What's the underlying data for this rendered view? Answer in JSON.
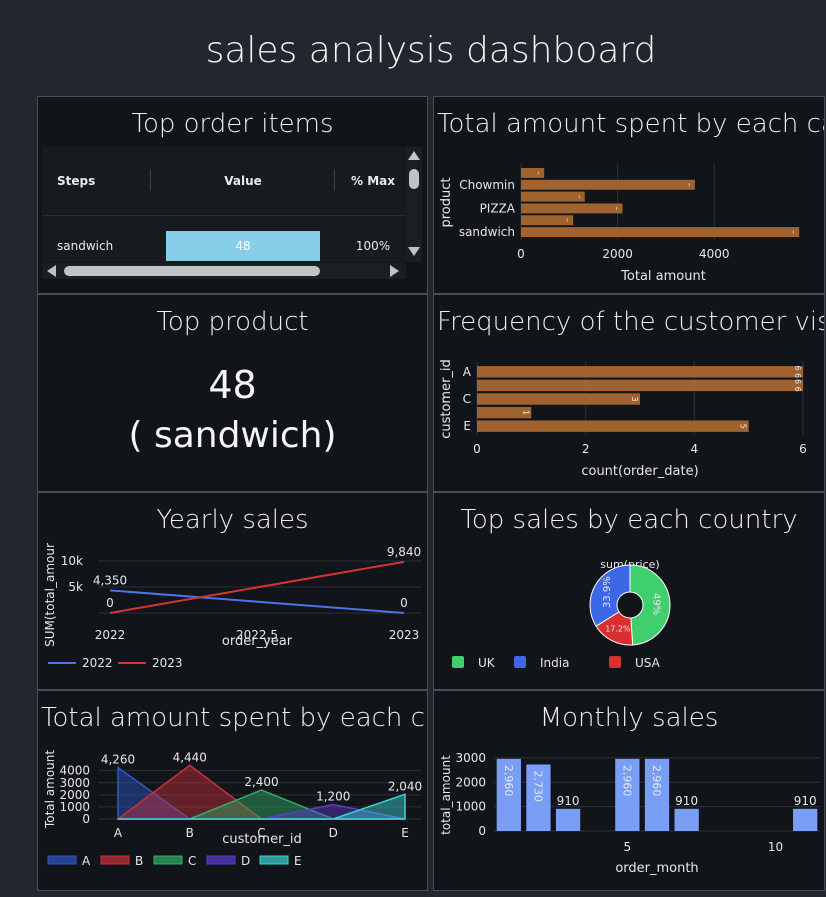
{
  "title": "sales analysis dashboard",
  "colors": {
    "bar_orange": "#a0622e",
    "line_blue": "#4c73e8",
    "line_red": "#d63434",
    "pie_uk": "#3fcf6d",
    "pie_india": "#3c67e6",
    "pie_usa": "#d92f2f",
    "bar_blue": "#7a9ef5",
    "cell_blue": "#87ceeb"
  },
  "top_items": {
    "title": "Top order items",
    "columns": [
      "Steps",
      "Value",
      "% Max"
    ],
    "rows": [
      {
        "step": "sandwich",
        "value": "48",
        "pct": "100%",
        "fraction": 1.0
      }
    ]
  },
  "top_product": {
    "title": "Top product",
    "value": "48",
    "label": "( sandwich)"
  },
  "chart_data": [
    {
      "id": "amount_by_category",
      "type": "bar",
      "orientation": "horizontal",
      "title": "Total amount spent by each ca...",
      "ylabel": "product",
      "xlabel": "Total amount",
      "categories": [
        "",
        "Chowmin",
        "",
        "PIZZA",
        "",
        "sandwich"
      ],
      "values": [
        480,
        3600,
        1320,
        2100,
        1080,
        5760
      ],
      "data_labels": [
        "–",
        "–",
        "–",
        "–",
        "–",
        "–"
      ],
      "xticks": [
        "0",
        "2000",
        "4000"
      ],
      "xlim": [
        0,
        5900
      ]
    },
    {
      "id": "customer_visits",
      "type": "bar",
      "orientation": "horizontal",
      "title": "Frequency of the customer visi...",
      "ylabel": "customer_id",
      "xlabel": "count(order_date)",
      "categories": [
        "A",
        "",
        "C",
        "",
        "E"
      ],
      "values": [
        6,
        6,
        3,
        1,
        5
      ],
      "data_labels": [
        "6 6",
        "6 6",
        "3",
        "1",
        "5"
      ],
      "xticks": [
        "0",
        "2",
        "4",
        "6"
      ],
      "xlim": [
        0,
        6
      ]
    },
    {
      "id": "yearly_sales",
      "type": "line",
      "title": "Yearly sales",
      "ylabel": "SUM(total_amour",
      "xlabel": "order_year",
      "x": [
        2022,
        2023
      ],
      "xticks": [
        "2022",
        "2022.5",
        "2023"
      ],
      "yticks": [
        "5k",
        "10k"
      ],
      "ylim": [
        0,
        10000
      ],
      "series": [
        {
          "name": "2022",
          "values": [
            4350,
            0
          ],
          "labels": [
            "4,350",
            "0"
          ]
        },
        {
          "name": "2023",
          "values": [
            0,
            9840
          ],
          "labels": [
            "0",
            "9,840"
          ]
        }
      ]
    },
    {
      "id": "country_sales",
      "type": "pie",
      "title": "Top sales by each country",
      "center_title": "sum(price)",
      "slices": [
        {
          "name": "UK",
          "value": 49,
          "label": "49%"
        },
        {
          "name": "USA",
          "value": 17.2,
          "label": "17.2%"
        },
        {
          "name": "India",
          "value": 33.9,
          "label": "33.9%"
        }
      ],
      "legend": [
        "UK",
        "India",
        "USA"
      ]
    },
    {
      "id": "amount_by_customer",
      "type": "area",
      "title": "Total amount spent by each cu...",
      "ylabel": "Total amount",
      "xlabel": "customer_id",
      "categories": [
        "A",
        "B",
        "C",
        "D",
        "E"
      ],
      "yticks": [
        "0",
        "1000",
        "2000",
        "3000",
        "4000"
      ],
      "ylim": [
        0,
        4800
      ],
      "series": [
        {
          "name": "A",
          "values": [
            4260,
            0,
            0,
            0,
            0
          ]
        },
        {
          "name": "B",
          "values": [
            0,
            4440,
            0,
            0,
            0
          ]
        },
        {
          "name": "C",
          "values": [
            0,
            0,
            2400,
            0,
            0
          ]
        },
        {
          "name": "D",
          "values": [
            0,
            0,
            0,
            1200,
            0
          ]
        },
        {
          "name": "E",
          "values": [
            0,
            0,
            0,
            0,
            2040
          ]
        }
      ],
      "peak_labels": [
        "4,260",
        "4,440",
        "2,400",
        "1,200",
        "2,040"
      ]
    },
    {
      "id": "monthly_sales",
      "type": "bar",
      "title": "Monthly sales",
      "ylabel": "total_amount",
      "xlabel": "order_month",
      "x": [
        1,
        2,
        3,
        5,
        6,
        7,
        11
      ],
      "values": [
        2960,
        2730,
        910,
        2960,
        2960,
        910,
        910
      ],
      "labels": [
        "2,960",
        "2,730",
        "910",
        "2,960",
        "2,960",
        "910",
        "910"
      ],
      "xticks": [
        "5",
        "10"
      ],
      "yticks": [
        "0",
        "1000",
        "2000",
        "3000"
      ],
      "xlim": [
        0.5,
        11.5
      ],
      "ylim": [
        0,
        3200
      ]
    }
  ]
}
